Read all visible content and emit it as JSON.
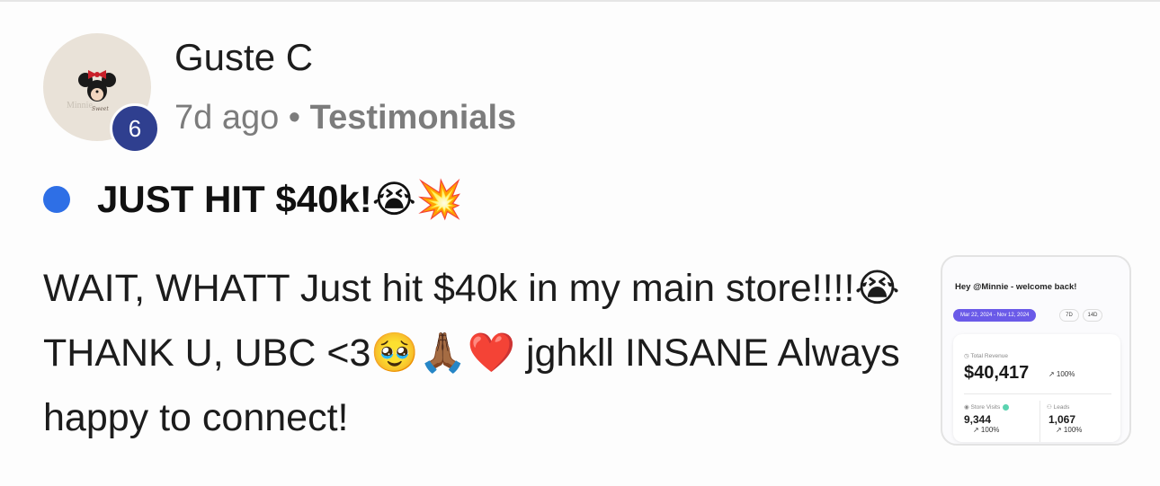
{
  "post": {
    "author": "Guste C",
    "level": "6",
    "time": "7d ago",
    "separator": "•",
    "category": "Testimonials",
    "title": "JUST HIT $40k!😭💥",
    "body": "WAIT, WHATT Just hit $40k in my main store!!!!😭 THANK U, UBC <3🥹🙏🏾❤️ jghkll INSANE Always happy to connect!",
    "unread_color": "#2e6fe6"
  },
  "thumbnail": {
    "greeting": "Hey @Minnie - welcome back!",
    "date_range": "Mar 22, 2024 - Nov 12, 2024",
    "chip_7d": "7D",
    "chip_14d": "14D",
    "total_revenue_label": "Total Revenue",
    "total_revenue": "$40,417",
    "total_revenue_change": "↗ 100%",
    "store_visits_label": "Store Visits",
    "store_visits": "9,344",
    "store_visits_change": "↗ 100%",
    "leads_label": "Leads",
    "leads": "1,067",
    "leads_change": "↗ 100%"
  }
}
